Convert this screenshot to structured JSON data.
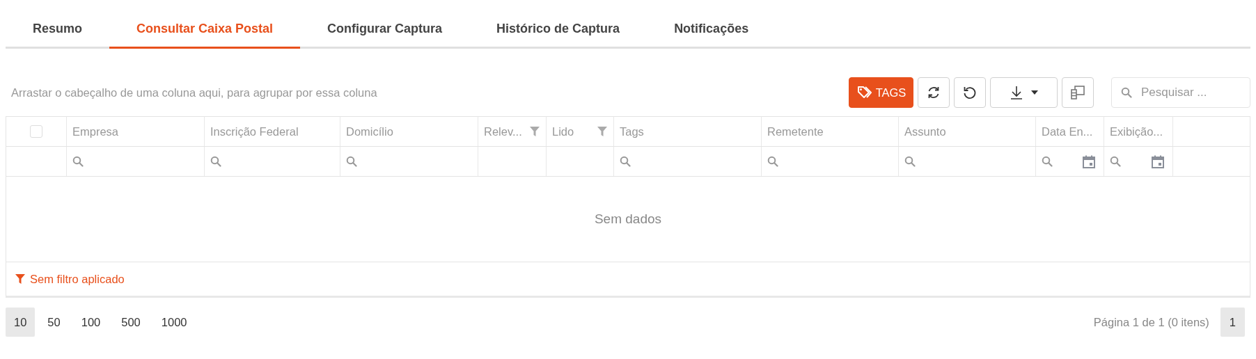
{
  "tabs": [
    {
      "label": "Resumo",
      "selected": false
    },
    {
      "label": "Consultar Caixa Postal",
      "selected": true
    },
    {
      "label": "Configurar Captura",
      "selected": false
    },
    {
      "label": "Histórico de Captura",
      "selected": false
    },
    {
      "label": "Notificações",
      "selected": false
    }
  ],
  "toolbar": {
    "group_hint": "Arrastar o cabeçalho de uma coluna aqui, para agrupar por essa coluna",
    "tags_button": "TAGS",
    "search": {
      "placeholder": "Pesquisar ..."
    }
  },
  "table": {
    "select_all": {
      "checked": false
    },
    "columns": [
      {
        "label": "Empresa",
        "kind": "text"
      },
      {
        "label": "Inscrição Federal",
        "kind": "text"
      },
      {
        "label": "Domicílio",
        "kind": "text"
      },
      {
        "label": "Relev...",
        "kind": "flag"
      },
      {
        "label": "Lido",
        "kind": "flag"
      },
      {
        "label": "Tags",
        "kind": "text"
      },
      {
        "label": "Remetente",
        "kind": "text"
      },
      {
        "label": "Assunto",
        "kind": "text"
      },
      {
        "label": "Data En...",
        "kind": "date"
      },
      {
        "label": "Exibição...",
        "kind": "date"
      }
    ],
    "empty_text": "Sem dados",
    "filter_status": "Sem filtro aplicado"
  },
  "pager": {
    "page_sizes": [
      {
        "label": "10",
        "selected": true
      },
      {
        "label": "50",
        "selected": false
      },
      {
        "label": "100",
        "selected": false
      },
      {
        "label": "500",
        "selected": false
      },
      {
        "label": "1000",
        "selected": false
      }
    ],
    "page_info": "Página 1 de 1 (0 itens)",
    "pages": [
      {
        "label": "1",
        "selected": true
      }
    ]
  }
}
